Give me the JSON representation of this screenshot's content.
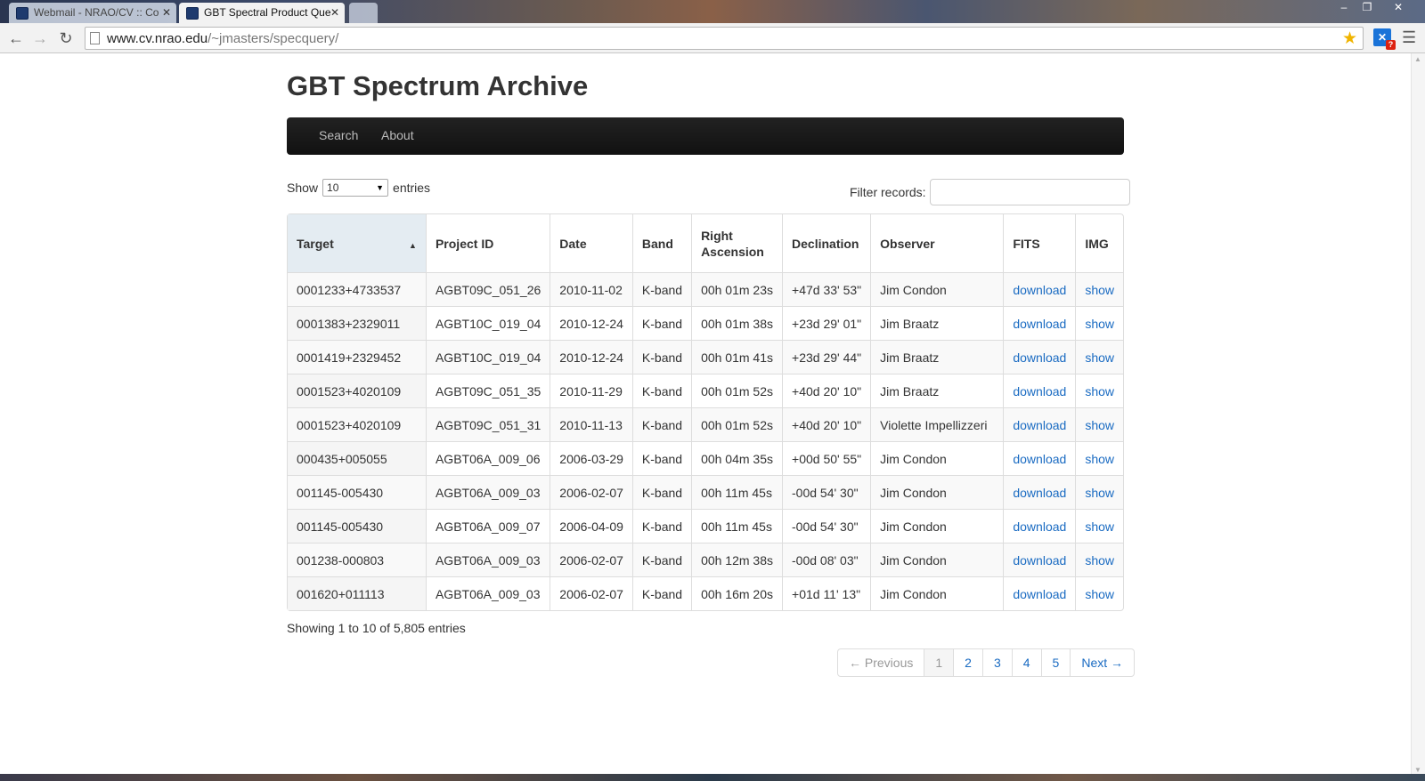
{
  "browser": {
    "tabs": [
      {
        "title": "Webmail - NRAO/CV :: Co",
        "active": false
      },
      {
        "title": "GBT Spectral Product Que",
        "active": true
      }
    ],
    "url_host": "www.cv.nrao.edu",
    "url_path": "/~jmasters/specquery/",
    "window_controls": {
      "minimize": "–",
      "restore": "❐",
      "close": "✕"
    },
    "nav": {
      "back": "←",
      "forward": "→",
      "reload": "↻"
    },
    "extension_badge": "?"
  },
  "page": {
    "title": "GBT Spectrum Archive",
    "nav_items": [
      "Search",
      "About"
    ],
    "length": {
      "show": "Show",
      "value": "10",
      "entries": "entries"
    },
    "filter_label": "Filter records:",
    "columns": [
      "Target",
      "Project ID",
      "Date",
      "Band",
      "Right Ascension",
      "Declination",
      "Observer",
      "FITS",
      "IMG"
    ],
    "rows": [
      {
        "target": "0001233+4733537",
        "project": "AGBT09C_051_26",
        "date": "2010-11-02",
        "band": "K-band",
        "ra": "00h 01m 23s",
        "dec": "+47d 33' 53\"",
        "observer": "Jim Condon",
        "fits": "download",
        "img": "show"
      },
      {
        "target": "0001383+2329011",
        "project": "AGBT10C_019_04",
        "date": "2010-12-24",
        "band": "K-band",
        "ra": "00h 01m 38s",
        "dec": "+23d 29' 01\"",
        "observer": "Jim Braatz",
        "fits": "download",
        "img": "show"
      },
      {
        "target": "0001419+2329452",
        "project": "AGBT10C_019_04",
        "date": "2010-12-24",
        "band": "K-band",
        "ra": "00h 01m 41s",
        "dec": "+23d 29' 44\"",
        "observer": "Jim Braatz",
        "fits": "download",
        "img": "show"
      },
      {
        "target": "0001523+4020109",
        "project": "AGBT09C_051_35",
        "date": "2010-11-29",
        "band": "K-band",
        "ra": "00h 01m 52s",
        "dec": "+40d 20' 10\"",
        "observer": "Jim Braatz",
        "fits": "download",
        "img": "show"
      },
      {
        "target": "0001523+4020109",
        "project": "AGBT09C_051_31",
        "date": "2010-11-13",
        "band": "K-band",
        "ra": "00h 01m 52s",
        "dec": "+40d 20' 10\"",
        "observer": "Violette Impellizzeri",
        "fits": "download",
        "img": "show"
      },
      {
        "target": "000435+005055",
        "project": "AGBT06A_009_06",
        "date": "2006-03-29",
        "band": "K-band",
        "ra": "00h 04m 35s",
        "dec": "+00d 50' 55\"",
        "observer": "Jim Condon",
        "fits": "download",
        "img": "show"
      },
      {
        "target": "001145-005430",
        "project": "AGBT06A_009_03",
        "date": "2006-02-07",
        "band": "K-band",
        "ra": "00h 11m 45s",
        "dec": "-00d 54' 30\"",
        "observer": "Jim Condon",
        "fits": "download",
        "img": "show"
      },
      {
        "target": "001145-005430",
        "project": "AGBT06A_009_07",
        "date": "2006-04-09",
        "band": "K-band",
        "ra": "00h 11m 45s",
        "dec": "-00d 54' 30\"",
        "observer": "Jim Condon",
        "fits": "download",
        "img": "show"
      },
      {
        "target": "001238-000803",
        "project": "AGBT06A_009_03",
        "date": "2006-02-07",
        "band": "K-band",
        "ra": "00h 12m 38s",
        "dec": "-00d 08' 03\"",
        "observer": "Jim Condon",
        "fits": "download",
        "img": "show"
      },
      {
        "target": "001620+011113",
        "project": "AGBT06A_009_03",
        "date": "2006-02-07",
        "band": "K-band",
        "ra": "00h 16m 20s",
        "dec": "+01d 11' 13\"",
        "observer": "Jim Condon",
        "fits": "download",
        "img": "show"
      }
    ],
    "info": "Showing 1 to 10 of 5,805 entries",
    "pagination": {
      "previous": "← Previous",
      "pages": [
        "1",
        "2",
        "3",
        "4",
        "5"
      ],
      "current": "1",
      "next": "Next →"
    }
  },
  "colors": {
    "link": "#1a6bc2",
    "navbar": "#1b1b1b",
    "sorted_header": "#e4ecf2"
  }
}
